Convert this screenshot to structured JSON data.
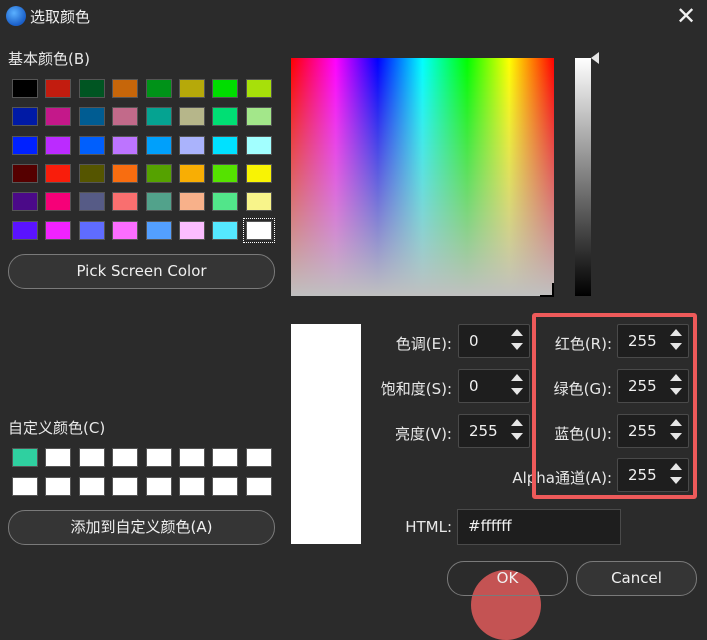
{
  "window": {
    "title": "选取颜色",
    "close_symbol": "✕"
  },
  "basic_colors": {
    "label": "基本颜色(B)",
    "swatches": [
      [
        "#000000",
        "#c21c0f",
        "#005522",
        "#c6660a",
        "#009218",
        "#b6a90a",
        "#00dd00",
        "#a7e00a"
      ],
      [
        "#001aa5",
        "#c4188a",
        "#005c92",
        "#c26a8a",
        "#05a391",
        "#b6b68a",
        "#00df74",
        "#a3e78a"
      ],
      [
        "#0021ff",
        "#bb2bff",
        "#005ffd",
        "#bd74ff",
        "#00a0fb",
        "#aab3fc",
        "#00e1ff",
        "#a2ffff"
      ],
      [
        "#550000",
        "#f91d0b",
        "#555500",
        "#f86d10",
        "#55a200",
        "#f8ae04",
        "#55e200",
        "#f8f304"
      ],
      [
        "#4b0a88",
        "#f60078",
        "#565b86",
        "#f96f6f",
        "#52a28b",
        "#f8b18a",
        "#52e58a",
        "#f8f48a"
      ],
      [
        "#5a13ff",
        "#f122ff",
        "#5f6cff",
        "#fb6dff",
        "#539fff",
        "#fbbdff",
        "#55e8ff",
        "#ffffff"
      ]
    ],
    "selected": "#ffffff"
  },
  "pick_screen_color_label": "Pick Screen Color",
  "custom_colors": {
    "label": "自定义颜色(C)",
    "swatches": [
      [
        "#2fd0a0",
        "#ffffff",
        "#ffffff",
        "#ffffff",
        "#ffffff",
        "#ffffff",
        "#ffffff",
        "#ffffff"
      ],
      [
        "#ffffff",
        "#ffffff",
        "#ffffff",
        "#ffffff",
        "#ffffff",
        "#ffffff",
        "#ffffff",
        "#ffffff"
      ]
    ]
  },
  "add_custom_label": "添加到自定义颜色(A)",
  "current_color": "#ffffff",
  "hsv": {
    "hue_label": "色调(E):",
    "hue_value": "0",
    "sat_label": "饱和度(S):",
    "sat_value": "0",
    "val_label": "亮度(V):",
    "val_value": "255"
  },
  "rgb": {
    "red_label": "红色(R):",
    "red_value": "255",
    "green_label": "绿色(G):",
    "green_value": "255",
    "blue_label": "蓝色(U):",
    "blue_value": "255",
    "alpha_label": "Alpha通道(A):",
    "alpha_value": "255"
  },
  "html": {
    "label": "HTML:",
    "value": "#ffffff"
  },
  "buttons": {
    "ok": "OK",
    "cancel": "Cancel"
  },
  "accent_colors": {
    "highlight": "#ee5a5a"
  }
}
